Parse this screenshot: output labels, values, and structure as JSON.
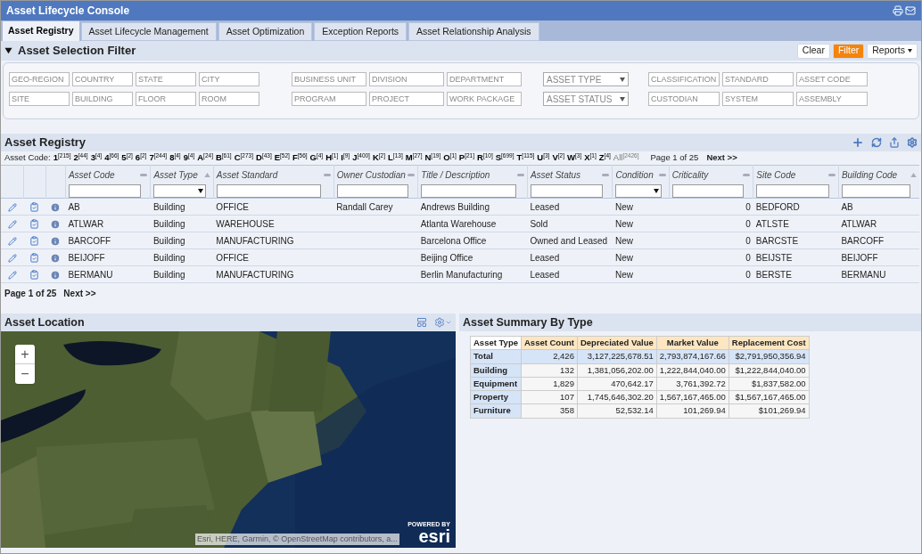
{
  "window": {
    "title": "Asset Lifecycle Console"
  },
  "tabs": [
    {
      "label": "Asset Registry",
      "selected": true
    },
    {
      "label": "Asset Lifecycle Management",
      "selected": false
    },
    {
      "label": "Asset Optimization",
      "selected": false
    },
    {
      "label": "Exception Reports",
      "selected": false
    },
    {
      "label": "Asset Relationship Analysis",
      "selected": false
    }
  ],
  "filter": {
    "title": "Asset Selection Filter",
    "expanded": true,
    "buttons": [
      {
        "label": "Clear",
        "kind": "plain"
      },
      {
        "label": "Filter",
        "kind": "primary"
      },
      {
        "label": "Reports",
        "kind": "menu"
      }
    ],
    "groups": [
      {
        "fields": [
          {
            "placeholder": "GEO-REGION",
            "kind": "text"
          },
          {
            "placeholder": "COUNTRY",
            "kind": "text"
          },
          {
            "placeholder": "STATE",
            "kind": "text"
          },
          {
            "placeholder": "CITY",
            "kind": "text"
          },
          {
            "placeholder": "SITE",
            "kind": "text"
          },
          {
            "placeholder": "BUILDING",
            "kind": "text"
          },
          {
            "placeholder": "FLOOR",
            "kind": "text"
          },
          {
            "placeholder": "ROOM",
            "kind": "text"
          }
        ]
      },
      {
        "fields": [
          {
            "placeholder": "BUSINESS UNIT",
            "kind": "text"
          },
          {
            "placeholder": "DIVISION",
            "kind": "text"
          },
          {
            "placeholder": "DEPARTMENT",
            "kind": "text"
          },
          {
            "placeholder": "PROGRAM",
            "kind": "text"
          },
          {
            "placeholder": "PROJECT",
            "kind": "text"
          },
          {
            "placeholder": "WORK PACKAGE",
            "kind": "text"
          }
        ]
      },
      {
        "fields": [
          {
            "placeholder": "ASSET TYPE",
            "kind": "select"
          },
          {
            "placeholder": "ASSET STATUS",
            "kind": "select"
          }
        ]
      },
      {
        "fields": [
          {
            "placeholder": "CLASSIFICATION",
            "kind": "text"
          },
          {
            "placeholder": "STANDARD",
            "kind": "text"
          },
          {
            "placeholder": "ASSET CODE",
            "kind": "text"
          },
          {
            "placeholder": "CUSTODIAN",
            "kind": "text"
          },
          {
            "placeholder": "SYSTEM",
            "kind": "text"
          },
          {
            "placeholder": "ASSEMBLY",
            "kind": "text"
          }
        ]
      }
    ]
  },
  "registry": {
    "title": "Asset Registry",
    "index_label": "Asset Code:",
    "index": [
      {
        "letter": "1",
        "count": "[215]",
        "kind": "letter"
      },
      {
        "letter": "2",
        "count": "[44]",
        "kind": "letter"
      },
      {
        "letter": "3",
        "count": "[4]",
        "kind": "letter"
      },
      {
        "letter": "4",
        "count": "[66]",
        "kind": "letter"
      },
      {
        "letter": "5",
        "count": "[2]",
        "kind": "letter"
      },
      {
        "letter": "6",
        "count": "[2]",
        "kind": "letter"
      },
      {
        "letter": "7",
        "count": "[244]",
        "kind": "letter"
      },
      {
        "letter": "8",
        "count": "[4]",
        "kind": "letter"
      },
      {
        "letter": "9",
        "count": "[4]",
        "kind": "letter"
      },
      {
        "letter": "A",
        "count": "[24]",
        "kind": "letter"
      },
      {
        "letter": "B",
        "count": "[61]",
        "kind": "letter"
      },
      {
        "letter": "C",
        "count": "[273]",
        "kind": "letter"
      },
      {
        "letter": "D",
        "count": "[43]",
        "kind": "letter"
      },
      {
        "letter": "E",
        "count": "[52]",
        "kind": "letter"
      },
      {
        "letter": "F",
        "count": "[56]",
        "kind": "letter"
      },
      {
        "letter": "G",
        "count": "[4]",
        "kind": "letter"
      },
      {
        "letter": "H",
        "count": "[1]",
        "kind": "letter"
      },
      {
        "letter": "I",
        "count": "[9]",
        "kind": "letter"
      },
      {
        "letter": "J",
        "count": "[400]",
        "kind": "letter"
      },
      {
        "letter": "K",
        "count": "[2]",
        "kind": "letter"
      },
      {
        "letter": "L",
        "count": "[13]",
        "kind": "letter"
      },
      {
        "letter": "M",
        "count": "[27]",
        "kind": "letter"
      },
      {
        "letter": "N",
        "count": "[19]",
        "kind": "letter"
      },
      {
        "letter": "O",
        "count": "[1]",
        "kind": "letter"
      },
      {
        "letter": "P",
        "count": "[21]",
        "kind": "letter"
      },
      {
        "letter": "R",
        "count": "[10]",
        "kind": "letter"
      },
      {
        "letter": "S",
        "count": "[699]",
        "kind": "letter"
      },
      {
        "letter": "T",
        "count": "[115]",
        "kind": "letter"
      },
      {
        "letter": "U",
        "count": "[3]",
        "kind": "letter"
      },
      {
        "letter": "V",
        "count": "[2]",
        "kind": "letter"
      },
      {
        "letter": "W",
        "count": "[3]",
        "kind": "letter"
      },
      {
        "letter": "X",
        "count": "[1]",
        "kind": "letter"
      },
      {
        "letter": "Z",
        "count": "[4]",
        "kind": "letter"
      },
      {
        "letter": "All",
        "count": "[2426]",
        "kind": "all"
      }
    ],
    "page_top": "Page 1 of 25",
    "next_top": "Next >>",
    "columns": [
      {
        "label": "Asset Code",
        "kind": "text",
        "sorted": false
      },
      {
        "label": "Asset Type",
        "kind": "select",
        "sorted": true
      },
      {
        "label": "Asset Standard",
        "kind": "text",
        "sorted": false
      },
      {
        "label": "Owner Custodian",
        "kind": "text",
        "sorted": false
      },
      {
        "label": "Title / Description",
        "kind": "text",
        "sorted": false
      },
      {
        "label": "Asset Status",
        "kind": "text",
        "sorted": false
      },
      {
        "label": "Condition",
        "kind": "select",
        "sorted": false
      },
      {
        "label": "Criticality",
        "kind": "number",
        "sorted": false
      },
      {
        "label": "Site Code",
        "kind": "text",
        "sorted": false
      },
      {
        "label": "Building Code",
        "kind": "text",
        "sorted": true
      }
    ],
    "rows": [
      [
        "AB",
        "Building",
        "OFFICE",
        "Randall Carey",
        "Andrews Building",
        "Leased",
        "New",
        "0",
        "BEDFORD",
        "AB"
      ],
      [
        "ATLWAR",
        "Building",
        "WAREHOUSE",
        "",
        "Atlanta Warehouse",
        "Sold",
        "New",
        "0",
        "ATLSTE",
        "ATLWAR"
      ],
      [
        "BARCOFF",
        "Building",
        "MANUFACTURING",
        "",
        "Barcelona Office",
        "Owned and Leased",
        "New",
        "0",
        "BARCSTE",
        "BARCOFF"
      ],
      [
        "BEIJOFF",
        "Building",
        "OFFICE",
        "",
        "Beijing Office",
        "Leased",
        "New",
        "0",
        "BEIJSTE",
        "BEIJOFF"
      ],
      [
        "BERMANU",
        "Building",
        "MANUFACTURING",
        "",
        "Berlin Manufacturing",
        "Leased",
        "New",
        "0",
        "BERSTE",
        "BERMANU"
      ]
    ],
    "page_bottom": "Page 1 of 25",
    "next_bottom": "Next >>"
  },
  "location": {
    "title": "Asset Location",
    "zoom_in": "+",
    "zoom_out": "−",
    "attribution": "Esri, HERE, Garmin, © OpenStreetMap contributors, a...",
    "logo_top": "POWERED BY",
    "logo": "esri"
  },
  "summary": {
    "title": "Asset Summary By Type",
    "columns": [
      "Asset Type",
      "Asset Count",
      "Depreciated Value",
      "Market Value",
      "Replacement Cost"
    ],
    "rows": [
      {
        "kind": "total",
        "cells": [
          "Total",
          "2,426",
          "3,127,225,678.51",
          "2,793,874,167.66",
          "$2,791,950,356.94"
        ]
      },
      {
        "kind": "row",
        "cells": [
          "Building",
          "132",
          "1,381,056,202.00",
          "1,222,844,040.00",
          "$1,222,844,040.00"
        ]
      },
      {
        "kind": "row",
        "cells": [
          "Equipment",
          "1,829",
          "470,642.17",
          "3,761,392.72",
          "$1,837,582.00"
        ]
      },
      {
        "kind": "row",
        "cells": [
          "Property",
          "107",
          "1,745,646,302.20",
          "1,567,167,465.00",
          "$1,567,167,465.00"
        ]
      },
      {
        "kind": "row",
        "cells": [
          "Furniture",
          "358",
          "52,532.14",
          "101,269.94",
          "$101,269.94"
        ]
      }
    ]
  }
}
